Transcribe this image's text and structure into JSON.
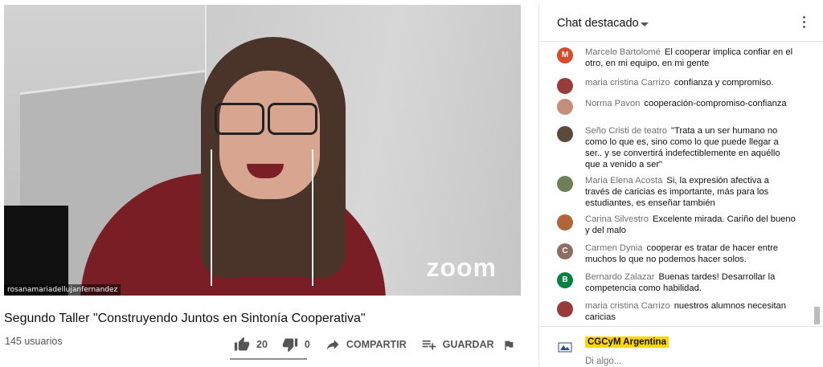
{
  "video": {
    "overlay_name": "rosanamariadellujanfernandez",
    "watermark": "zoom"
  },
  "info": {
    "title": "Segundo Taller \"Construyendo Juntos en Sintonía Cooperativa\"",
    "views": "145 usuarios",
    "likes": "20",
    "dislikes": "0",
    "share_label": "COMPARTIR",
    "save_label": "GUARDAR",
    "like_ratio": 1.0
  },
  "chat": {
    "title": "Chat destacado",
    "messages": [
      {
        "author": "Marcelo Bartolomé",
        "text": "El cooperar implica confiar en el otro, en mi equipo, en mi gente",
        "avatar_letter": "M",
        "avatar_color": "#d84a2c"
      },
      {
        "author": "maria cristina Carrizo",
        "text": "confianza y compromiso.",
        "avatar_letter": "",
        "avatar_color": "#9a3b3b"
      },
      {
        "author": "Norma Pavon",
        "text": "cooperación-compromiso-confianza",
        "avatar_letter": "",
        "avatar_color": "#c48f7a"
      },
      {
        "author": "Seño Cristi de teatro",
        "text": "\"Trata a un ser humano no como lo que es, sino como lo que puede llegar a ser.. y se convertirá indefectiblemente en aquéllo que a venido a ser\"",
        "avatar_letter": "",
        "avatar_color": "#5a4a3c"
      },
      {
        "author": "Maria Elena Acosta",
        "text": "Si, la expresión afectiva a través de caricias es importante, más para los estudiantes, es enseñar también",
        "avatar_letter": "",
        "avatar_color": "#6f7f5a"
      },
      {
        "author": "Carina Silvestro",
        "text": "Excelente mirada. Cariño del bueno y del malo",
        "avatar_letter": "",
        "avatar_color": "#b0653a"
      },
      {
        "author": "Carmen Dynia",
        "text": "cooperar es tratar de hacer entre muchos lo que no podemos hacer solos.",
        "avatar_letter": "C",
        "avatar_color": "#8d6e63"
      },
      {
        "author": "Bernardo Zalazar",
        "text": "Buenas tardes! Desarrollar la competencia como habilidad.",
        "avatar_letter": "B",
        "avatar_color": "#0b8043"
      },
      {
        "author": "maria cristina Carrizo",
        "text": "nuestros alumnos necesitan caricias",
        "avatar_letter": "",
        "avatar_color": "#9a3b3b"
      }
    ],
    "input": {
      "user_name": "CGCyM Argentina",
      "placeholder": "Di algo..."
    }
  },
  "colors": {
    "accent_chip": "#ffd600",
    "chat_author": "#707070",
    "icon_gray": "#555555"
  }
}
